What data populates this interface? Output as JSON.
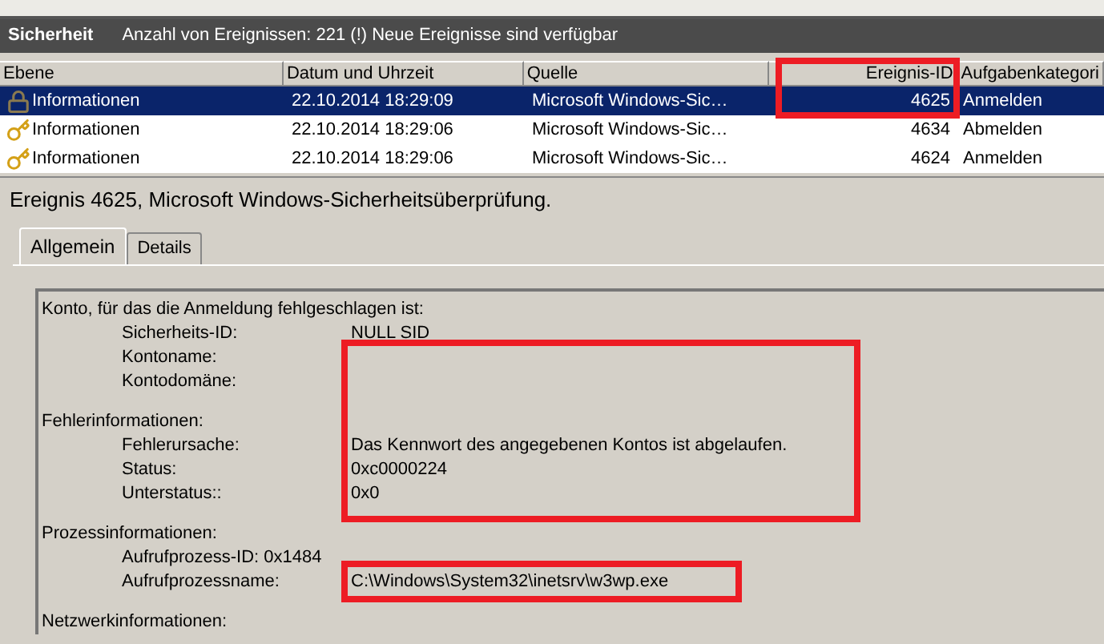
{
  "log_header": {
    "title": "Sicherheit",
    "summary": "Anzahl von Ereignissen: 221 (!) Neue Ereignisse sind verfügbar"
  },
  "table": {
    "columns": [
      "Ebene",
      "Datum und Uhrzeit",
      "Quelle",
      "Ereignis-ID",
      "Aufgabenkategori"
    ],
    "rows": [
      {
        "kind": "failure",
        "selected": true,
        "level": "Informationen",
        "date": "22.10.2014 18:29:09",
        "source": "Microsoft Windows-Sic…",
        "event_id": "4625",
        "category": "Anmelden"
      },
      {
        "kind": "success",
        "selected": false,
        "level": "Informationen",
        "date": "22.10.2014 18:29:06",
        "source": "Microsoft Windows-Sic…",
        "event_id": "4634",
        "category": "Abmelden"
      },
      {
        "kind": "success",
        "selected": false,
        "level": "Informationen",
        "date": "22.10.2014 18:29:06",
        "source": "Microsoft Windows-Sic…",
        "event_id": "4624",
        "category": "Anmelden"
      }
    ]
  },
  "event_title": "Ereignis 4625, Microsoft Windows-Sicherheitsüberprüfung.",
  "tabs": [
    {
      "label": "Allgemein",
      "selected": true
    },
    {
      "label": "Details",
      "selected": false
    }
  ],
  "details": [
    {
      "heading": "Konto, für das die Anmeldung fehlgeschlagen ist:",
      "fields": [
        {
          "kind": "column",
          "label": "Sicherheits-ID:",
          "value": "NULL SID"
        },
        {
          "kind": "column",
          "label": "Kontoname:"
        },
        {
          "kind": "column",
          "label": "Kontodomäne:"
        }
      ]
    },
    {
      "heading": "Fehlerinformationen:",
      "fields": [
        {
          "kind": "column",
          "label": "Fehlerursache:",
          "value": "Das Kennwort des angegebenen Kontos ist abgelaufen."
        },
        {
          "kind": "column",
          "label": "Status:",
          "value": "0xc0000224"
        },
        {
          "kind": "column",
          "label": "Unterstatus::",
          "value": "0x0"
        }
      ]
    },
    {
      "heading": "Prozessinformationen:",
      "fields": [
        {
          "kind": "inline",
          "label": "Aufrufprozess-ID:",
          "value": "0x1484"
        },
        {
          "kind": "column",
          "label": "Aufrufprozessname:",
          "value": "C:\\Windows\\System32\\inetsrv\\w3wp.exe"
        }
      ]
    },
    {
      "heading": "Netzwerkinformationen:"
    }
  ]
}
